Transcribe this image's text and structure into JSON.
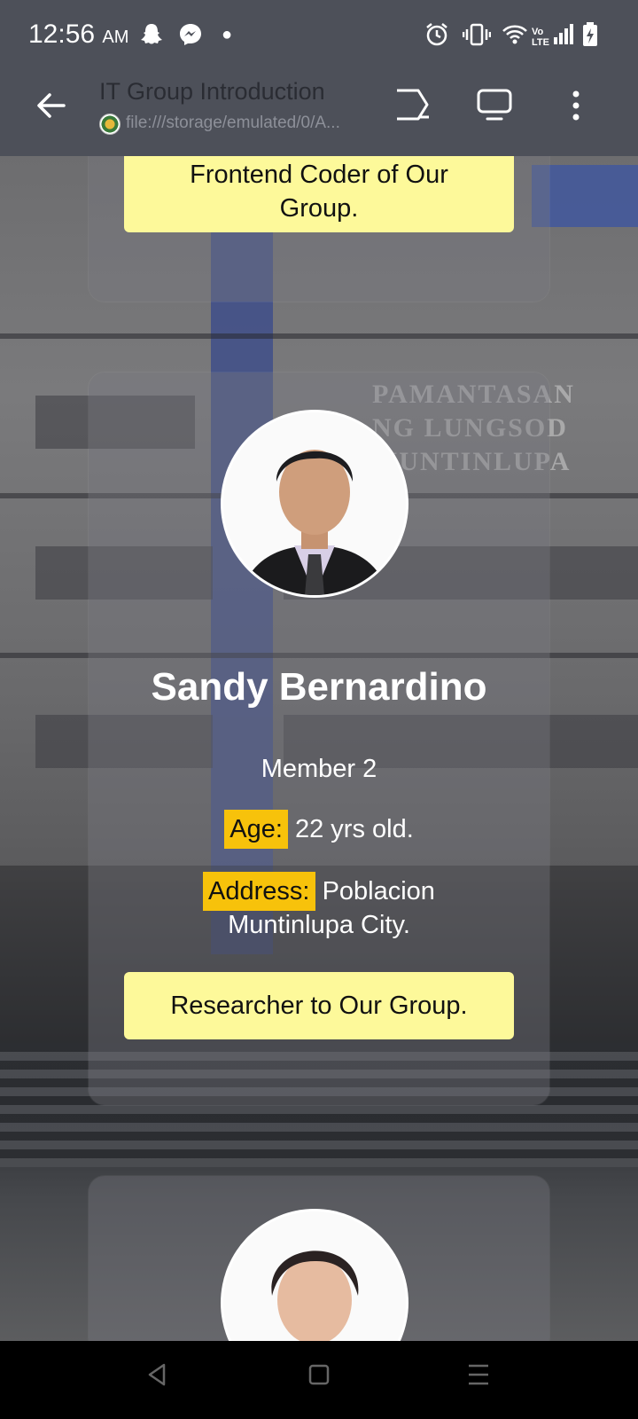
{
  "status_bar": {
    "time": "12:56",
    "ampm": "AM",
    "icons": [
      "snapchat-icon",
      "messenger-icon",
      "dot-icon",
      "alarm-icon",
      "vibrate-icon",
      "wifi-icon",
      "volte-icon",
      "signal-icon",
      "battery-icon"
    ]
  },
  "browser": {
    "title": "IT Group Introduction",
    "url": "file:///storage/emulated/0/A..."
  },
  "background": {
    "sign_lines": [
      "PAMANTASAN",
      "NG LUNGSOD",
      "MUNTINLUPA"
    ]
  },
  "cards": [
    {
      "role": "Frontend Coder of Our Group."
    },
    {
      "name": "Sandy Bernardino",
      "member": "Member 2",
      "age_label": "Age:",
      "age_value": "22 yrs old.",
      "address_label": "Address:",
      "address_value_line1": "Poblacion",
      "address_value_line2": "Muntinlupa City.",
      "role": "Researcher to Our Group."
    },
    {
      "avatar": "person-photo"
    }
  ],
  "colors": {
    "highlight": "#f7c20b",
    "role_box": "#fdf99a",
    "toolbar": "#4d5059"
  }
}
